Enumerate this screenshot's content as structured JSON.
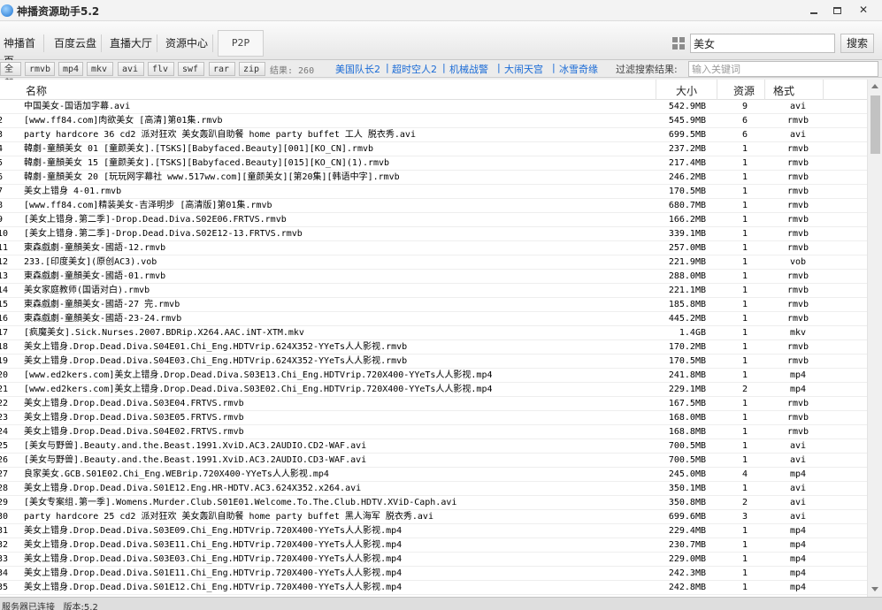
{
  "app": {
    "title": "神播资源助手5.2"
  },
  "nav": [
    "神播首页",
    "百度云盘",
    "直播大厅",
    "资源中心",
    "P2P"
  ],
  "search": {
    "value": "美女",
    "button": "搜索"
  },
  "formats": [
    "全部",
    "rmvb",
    "mp4",
    "mkv",
    "avi",
    "flv",
    "swf",
    "rar",
    "zip"
  ],
  "result_count": "结果: 260",
  "hot_links": [
    "美国队长2",
    "超时空人2",
    "机械战警",
    "大闹天宫",
    "冰雪奇缘"
  ],
  "filter": {
    "label": "过滤搜索结果:",
    "placeholder": "输入关键词"
  },
  "table": {
    "columns": [
      "名称",
      "大小",
      "资源",
      "格式"
    ],
    "rows": [
      {
        "idx": "",
        "name": "中国美女-国语加字幕.avi",
        "size": "542.9MB",
        "src": "9",
        "fmt": "avi"
      },
      {
        "idx": "2",
        "name": "[www.ff84.com]肉欲美女 [高清]第01集.rmvb",
        "size": "545.9MB",
        "src": "6",
        "fmt": "rmvb"
      },
      {
        "idx": "3",
        "name": "party hardcore 36 cd2 派对狂欢 美女轰趴自助餐 home party buffet 工人 脱衣秀.avi",
        "size": "699.5MB",
        "src": "6",
        "fmt": "avi"
      },
      {
        "idx": "4",
        "name": "韓劇-童顏美女 01 [童颜美女].[TSKS][Babyfaced.Beauty][001][KO_CN].rmvb",
        "size": "237.2MB",
        "src": "1",
        "fmt": "rmvb"
      },
      {
        "idx": "5",
        "name": "韓劇-童顏美女 15 [童颜美女].[TSKS][Babyfaced.Beauty][015][KO_CN](1).rmvb",
        "size": "217.4MB",
        "src": "1",
        "fmt": "rmvb"
      },
      {
        "idx": "6",
        "name": "韓劇-童顏美女 20 [玩玩网字幕社 www.517ww.com][童颜美女][第20集][韩语中字].rmvb",
        "size": "246.2MB",
        "src": "1",
        "fmt": "rmvb"
      },
      {
        "idx": "7",
        "name": "美女上错身 4-01.rmvb",
        "size": "170.5MB",
        "src": "1",
        "fmt": "rmvb"
      },
      {
        "idx": "8",
        "name": "[www.ff84.com]精装美女-吉泽明步 [高清版]第01集.rmvb",
        "size": "680.7MB",
        "src": "1",
        "fmt": "rmvb"
      },
      {
        "idx": "9",
        "name": "[美女上错身.第二季]-Drop.Dead.Diva.S02E06.FRTVS.rmvb",
        "size": "166.2MB",
        "src": "1",
        "fmt": "rmvb"
      },
      {
        "idx": "10",
        "name": "[美女上错身.第二季]-Drop.Dead.Diva.S02E12-13.FRTVS.rmvb",
        "size": "339.1MB",
        "src": "1",
        "fmt": "rmvb"
      },
      {
        "idx": "11",
        "name": "東森戲劇-童顏美女-國語-12.rmvb",
        "size": "257.0MB",
        "src": "1",
        "fmt": "rmvb"
      },
      {
        "idx": "12",
        "name": "233.[印度美女](原创AC3).vob",
        "size": "221.9MB",
        "src": "1",
        "fmt": "vob"
      },
      {
        "idx": "13",
        "name": "東森戲劇-童顏美女-國語-01.rmvb",
        "size": "288.0MB",
        "src": "1",
        "fmt": "rmvb"
      },
      {
        "idx": "14",
        "name": "美女家庭教师(国语对白).rmvb",
        "size": "221.1MB",
        "src": "1",
        "fmt": "rmvb"
      },
      {
        "idx": "15",
        "name": "東森戲劇-童顏美女-國語-27 完.rmvb",
        "size": "185.8MB",
        "src": "1",
        "fmt": "rmvb"
      },
      {
        "idx": "16",
        "name": "東森戲劇-童顏美女-國語-23-24.rmvb",
        "size": "445.2MB",
        "src": "1",
        "fmt": "rmvb"
      },
      {
        "idx": "17",
        "name": "[疯魔美女].Sick.Nurses.2007.BDRip.X264.AAC.iNT-XTM.mkv",
        "size": "1.4GB",
        "src": "1",
        "fmt": "mkv"
      },
      {
        "idx": "18",
        "name": "美女上错身.Drop.Dead.Diva.S04E01.Chi_Eng.HDTVrip.624X352-YYeTs人人影视.rmvb",
        "size": "170.2MB",
        "src": "1",
        "fmt": "rmvb"
      },
      {
        "idx": "19",
        "name": "美女上错身.Drop.Dead.Diva.S04E03.Chi_Eng.HDTVrip.624X352-YYeTs人人影视.rmvb",
        "size": "170.5MB",
        "src": "1",
        "fmt": "rmvb"
      },
      {
        "idx": "20",
        "name": "[www.ed2kers.com]美女上错身.Drop.Dead.Diva.S03E13.Chi_Eng.HDTVrip.720X400-YYeTs人人影视.mp4",
        "size": "241.8MB",
        "src": "1",
        "fmt": "mp4"
      },
      {
        "idx": "21",
        "name": "[www.ed2kers.com]美女上错身.Drop.Dead.Diva.S03E02.Chi_Eng.HDTVrip.720X400-YYeTs人人影视.mp4",
        "size": "229.1MB",
        "src": "2",
        "fmt": "mp4"
      },
      {
        "idx": "22",
        "name": "美女上错身.Drop.Dead.Diva.S03E04.FRTVS.rmvb",
        "size": "167.5MB",
        "src": "1",
        "fmt": "rmvb"
      },
      {
        "idx": "23",
        "name": "美女上错身.Drop.Dead.Diva.S03E05.FRTVS.rmvb",
        "size": "168.0MB",
        "src": "1",
        "fmt": "rmvb"
      },
      {
        "idx": "24",
        "name": "美女上错身.Drop.Dead.Diva.S04E02.FRTVS.rmvb",
        "size": "168.8MB",
        "src": "1",
        "fmt": "rmvb"
      },
      {
        "idx": "25",
        "name": "[美女与野兽].Beauty.and.the.Beast.1991.XviD.AC3.2AUDIO.CD2-WAF.avi",
        "size": "700.5MB",
        "src": "1",
        "fmt": "avi"
      },
      {
        "idx": "26",
        "name": "[美女与野兽].Beauty.and.the.Beast.1991.XviD.AC3.2AUDIO.CD3-WAF.avi",
        "size": "700.5MB",
        "src": "1",
        "fmt": "avi"
      },
      {
        "idx": "27",
        "name": "良家美女.GCB.S01E02.Chi_Eng.WEBrip.720X400-YYeTs人人影视.mp4",
        "size": "245.0MB",
        "src": "4",
        "fmt": "mp4"
      },
      {
        "idx": "28",
        "name": "美女上错身.Drop.Dead.Diva.S01E12.Eng.HR-HDTV.AC3.624X352.x264.avi",
        "size": "350.1MB",
        "src": "1",
        "fmt": "avi"
      },
      {
        "idx": "29",
        "name": "[美女专案组.第一季].Womens.Murder.Club.S01E01.Welcome.To.The.Club.HDTV.XViD-Caph.avi",
        "size": "350.8MB",
        "src": "2",
        "fmt": "avi"
      },
      {
        "idx": "30",
        "name": "party hardcore 25 cd2 派对狂欢 美女轰趴自助餐 home party buffet 黑人海军 脱衣秀.avi",
        "size": "699.6MB",
        "src": "3",
        "fmt": "avi"
      },
      {
        "idx": "31",
        "name": "美女上错身.Drop.Dead.Diva.S03E09.Chi_Eng.HDTVrip.720X400-YYeTs人人影视.mp4",
        "size": "229.4MB",
        "src": "1",
        "fmt": "mp4"
      },
      {
        "idx": "32",
        "name": "美女上错身.Drop.Dead.Diva.S03E11.Chi_Eng.HDTVrip.720X400-YYeTs人人影视.mp4",
        "size": "230.7MB",
        "src": "1",
        "fmt": "mp4"
      },
      {
        "idx": "33",
        "name": "美女上错身.Drop.Dead.Diva.S03E03.Chi_Eng.HDTVrip.720X400-YYeTs人人影视.mp4",
        "size": "229.0MB",
        "src": "1",
        "fmt": "mp4"
      },
      {
        "idx": "34",
        "name": "美女上错身.Drop.Dead.Diva.S01E11.Chi_Eng.HDTVrip.720X400-YYeTs人人影视.mp4",
        "size": "242.3MB",
        "src": "1",
        "fmt": "mp4"
      },
      {
        "idx": "35",
        "name": "美女上错身.Drop.Dead.Diva.S01E12.Chi_Eng.HDTVrip.720X400-YYeTs人人影视.mp4",
        "size": "242.8MB",
        "src": "1",
        "fmt": "mp4"
      }
    ]
  },
  "status": {
    "text": "服务器已连接   版本:5.2"
  },
  "colors": {
    "link": "#1a6bd6",
    "accent": "#1c73d2"
  }
}
